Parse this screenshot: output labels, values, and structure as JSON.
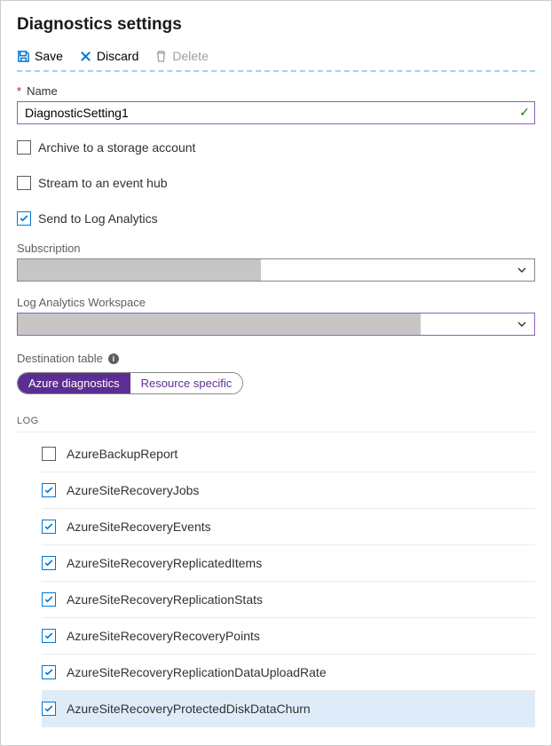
{
  "title": "Diagnostics settings",
  "toolbar": {
    "save_label": "Save",
    "discard_label": "Discard",
    "delete_label": "Delete"
  },
  "name_section": {
    "label": "Name",
    "value": "DiagnosticSetting1"
  },
  "archive": {
    "label": "Archive to a storage account",
    "checked": false
  },
  "eventhub": {
    "label": "Stream to an event hub",
    "checked": false
  },
  "log_analytics": {
    "label": "Send to Log Analytics",
    "checked": true,
    "subscription_label": "Subscription",
    "workspace_label": "Log Analytics Workspace"
  },
  "destination": {
    "label": "Destination table",
    "option_a": "Azure diagnostics",
    "option_b": "Resource specific",
    "selected": "a"
  },
  "log_section": {
    "header": "LOG",
    "items": [
      {
        "label": "AzureBackupReport",
        "checked": false
      },
      {
        "label": "AzureSiteRecoveryJobs",
        "checked": true
      },
      {
        "label": "AzureSiteRecoveryEvents",
        "checked": true
      },
      {
        "label": "AzureSiteRecoveryReplicatedItems",
        "checked": true
      },
      {
        "label": "AzureSiteRecoveryReplicationStats",
        "checked": true
      },
      {
        "label": "AzureSiteRecoveryRecoveryPoints",
        "checked": true
      },
      {
        "label": "AzureSiteRecoveryReplicationDataUploadRate",
        "checked": true
      },
      {
        "label": "AzureSiteRecoveryProtectedDiskDataChurn",
        "checked": true,
        "highlight": true
      }
    ]
  }
}
